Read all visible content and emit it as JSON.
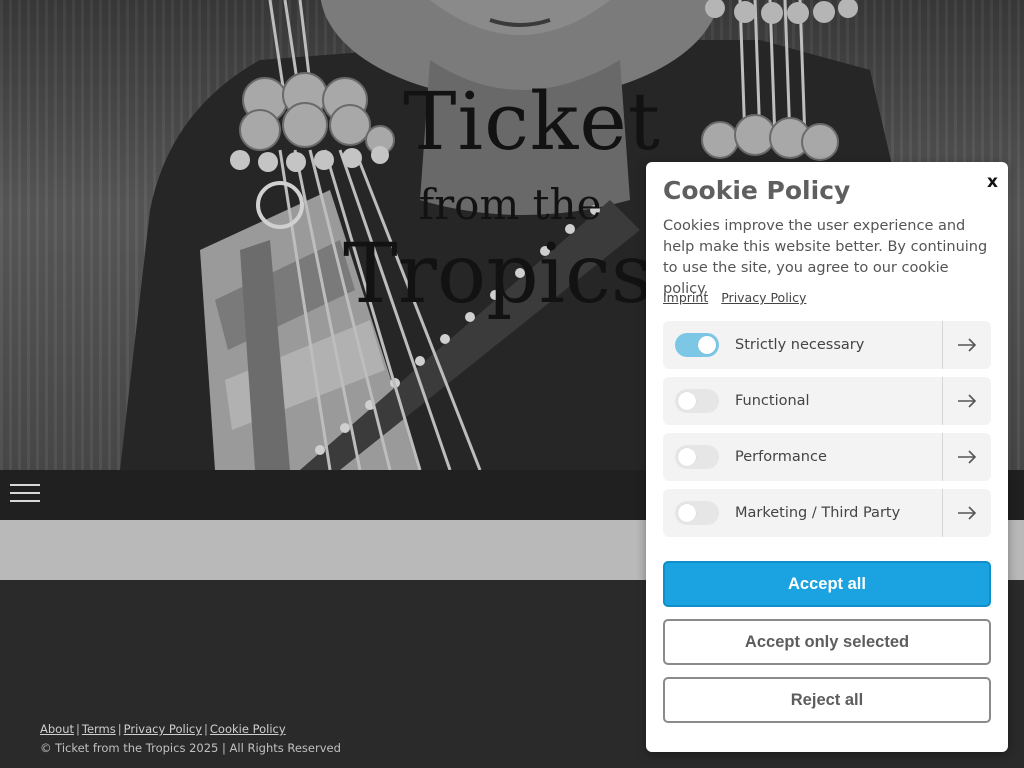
{
  "hero": {
    "title_line1": "Ticket",
    "title_line2": "from the",
    "title_line3": "Tropics"
  },
  "nav": {
    "menu_icon": "hamburger-menu-icon"
  },
  "footer": {
    "links": [
      "About",
      "Terms",
      "Privacy Policy",
      "Cookie Policy"
    ],
    "separator": "|",
    "copyright": "© Ticket from the Tropics 2025 | All Rights Reserved"
  },
  "cookie": {
    "title": "Cookie Policy",
    "close_label": "x",
    "text": "Cookies improve the user experience and help make this website better. By continuing to use the site, you agree to our cookie policy.",
    "links": [
      "Imprint",
      "Privacy Policy"
    ],
    "categories": [
      {
        "label": "Strictly necessary",
        "enabled": true
      },
      {
        "label": "Functional",
        "enabled": false
      },
      {
        "label": "Performance",
        "enabled": false
      },
      {
        "label": "Marketing / Third Party",
        "enabled": false
      }
    ],
    "accept_all": "Accept all",
    "accept_selected": "Accept only selected",
    "reject_all": "Reject all",
    "colors": {
      "primary": "#1aa3e0",
      "toggle_on": "#7cc7e6",
      "toggle_off": "#e6e6e6"
    },
    "arrow_icon": "arrow-right-icon"
  }
}
